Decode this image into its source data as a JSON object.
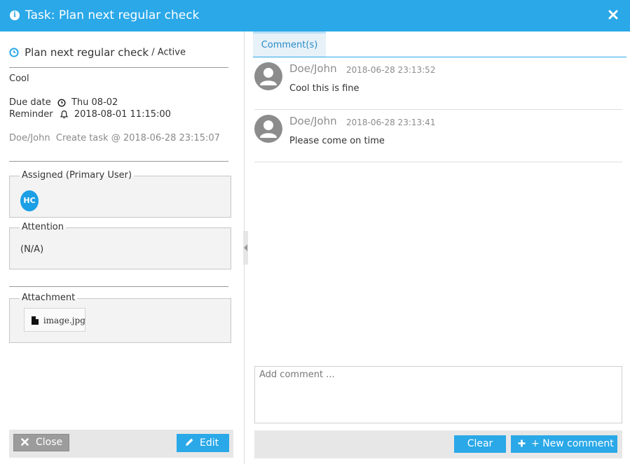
{
  "dialog": {
    "title": "Task: Plan next regular check",
    "accent_color": "#2aa8e8"
  },
  "task": {
    "name": "Plan next regular check",
    "status": "/ Active",
    "description": "Cool",
    "due_label": "Due date",
    "due_value": "Thu 08-02",
    "reminder_label": "Reminder",
    "reminder_value": "2018-08-01 11:15:00",
    "creator": "Doe/John  Create task @ 2018-06-28 23:15:07"
  },
  "assigned": {
    "legend": "Assigned (Primary User)",
    "users": [
      "HC"
    ]
  },
  "attention": {
    "legend": "Attention",
    "value": "(N/A)"
  },
  "attachment": {
    "legend": "Attachment",
    "files": [
      "image.jpg"
    ]
  },
  "left_footer": {
    "close_label": "Close",
    "edit_label": "Edit"
  },
  "tabs": [
    {
      "label": "Comment(s)",
      "active": true
    }
  ],
  "comments": [
    {
      "author": "Doe/John",
      "time": "2018-06-28 23:13:52",
      "text": "Cool this is fine"
    },
    {
      "author": "Doe/John",
      "time": "2018-06-28 23:13:41",
      "text": "Please come on time"
    }
  ],
  "comment_input": {
    "placeholder": "Add comment ..."
  },
  "right_footer": {
    "clear_label": "Clear",
    "new_comment_label": "+ New comment"
  },
  "icons": {
    "title": "info-icon",
    "close": "close-icon",
    "task": "clock-icon",
    "due": "clock-icon",
    "reminder": "bell-icon",
    "file": "file-icon",
    "edit": "pencil-icon",
    "add": "plus-icon",
    "avatar": "user-avatar-icon"
  }
}
